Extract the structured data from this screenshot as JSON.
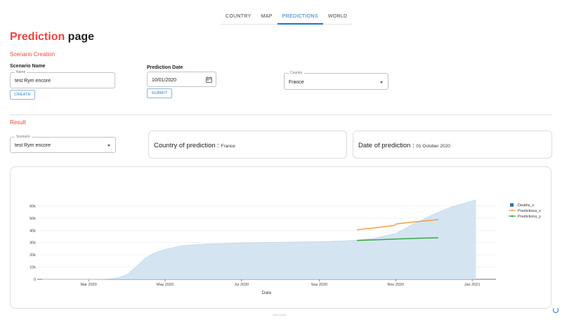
{
  "nav": {
    "tabs": [
      {
        "label": "COUNTRY",
        "active": false
      },
      {
        "label": "MAP",
        "active": false
      },
      {
        "label": "PREDICTIONS",
        "active": true
      },
      {
        "label": "WORLD",
        "active": false
      }
    ]
  },
  "header": {
    "title_accent": "Prediction",
    "title_rest": " page"
  },
  "scenario_creation": {
    "section_label": "Scenario Creation",
    "scenario_name_heading": "Scenario Name",
    "name_field_label": "Name",
    "name_value": "test Rym encore",
    "create_label": "CREATE",
    "prediction_date_heading": "Prediction Date",
    "date_value": "10/01/2020",
    "submit_label": "SUBMIT",
    "country_field_label": "Country",
    "country_value": "France"
  },
  "result": {
    "section_label": "Result",
    "scenario_field_label": "Scenario",
    "scenario_value": "test Rym encore",
    "country_card_label": "Country of prediction : ",
    "country_card_value": "France",
    "date_card_label": "Date of prediction : ",
    "date_card_value": "01 October 2020"
  },
  "chart_data": {
    "type": "area",
    "xlabel": "Date",
    "ylabel": "",
    "ylim": [
      0,
      70000
    ],
    "yticks": [
      0,
      10000,
      20000,
      30000,
      40000,
      50000,
      60000
    ],
    "ytick_labels": [
      "0",
      "10k",
      "20k",
      "30k",
      "40k",
      "50k",
      "60k"
    ],
    "xtick_labels": [
      "Mar 2020",
      "May 2020",
      "Jul 2020",
      "Sep 2020",
      "Nov 2020",
      "Jan 2021"
    ],
    "xtick_dates": [
      "2020-03-01",
      "2020-05-01",
      "2020-07-01",
      "2020-09-01",
      "2020-11-01",
      "2021-01-01"
    ],
    "xlim": [
      "2020-01-20",
      "2021-01-20"
    ],
    "legend_position": "right",
    "series": [
      {
        "name": "Deaths_x",
        "type": "area",
        "color": "#1f77b4",
        "points": [
          [
            "2020-01-24",
            0
          ],
          [
            "2020-03-01",
            2
          ],
          [
            "2020-03-15",
            100
          ],
          [
            "2020-03-25",
            1300
          ],
          [
            "2020-04-01",
            4000
          ],
          [
            "2020-04-08",
            10300
          ],
          [
            "2020-04-15",
            17000
          ],
          [
            "2020-04-22",
            21300
          ],
          [
            "2020-05-01",
            24500
          ],
          [
            "2020-05-15",
            27500
          ],
          [
            "2020-06-01",
            28800
          ],
          [
            "2020-07-01",
            29800
          ],
          [
            "2020-08-01",
            30300
          ],
          [
            "2020-09-01",
            30700
          ],
          [
            "2020-09-20",
            31300
          ],
          [
            "2020-10-01",
            32000
          ],
          [
            "2020-10-15",
            33500
          ],
          [
            "2020-11-01",
            37500
          ],
          [
            "2020-11-15",
            45000
          ],
          [
            "2020-12-01",
            53000
          ],
          [
            "2020-12-15",
            59000
          ],
          [
            "2021-01-01",
            64000
          ],
          [
            "2021-01-04",
            65000
          ]
        ]
      },
      {
        "name": "Predictions_x",
        "type": "line",
        "color": "#f5a04a",
        "points": [
          [
            "2020-10-01",
            40500
          ],
          [
            "2020-10-15",
            42000
          ],
          [
            "2020-10-31",
            44000
          ],
          [
            "2020-11-01",
            45200
          ],
          [
            "2020-11-15",
            46800
          ],
          [
            "2020-12-01",
            48400
          ],
          [
            "2020-12-05",
            48800
          ]
        ]
      },
      {
        "name": "Predictions_y",
        "type": "line",
        "color": "#3aa745",
        "points": [
          [
            "2020-10-01",
            31800
          ],
          [
            "2020-10-20",
            32400
          ],
          [
            "2020-11-10",
            33300
          ],
          [
            "2020-12-05",
            34000
          ]
        ]
      }
    ]
  },
  "footer": {
    "text": "Siao mode"
  }
}
